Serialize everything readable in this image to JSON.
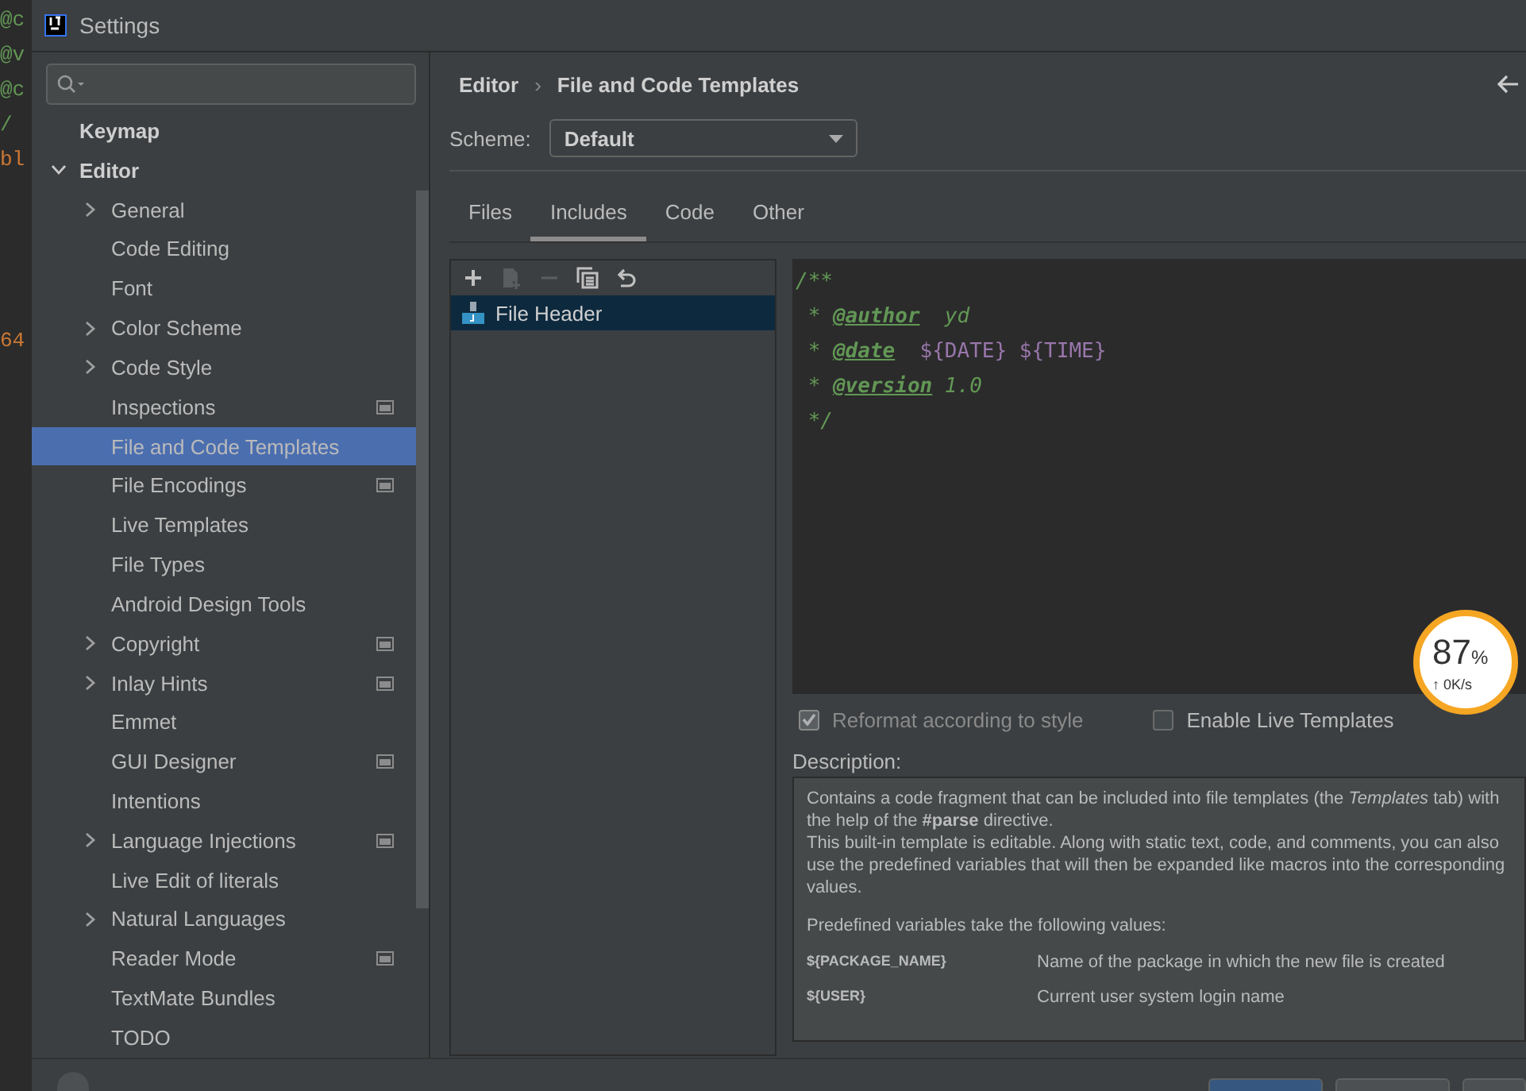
{
  "background_code": [
    "@c",
    "@v",
    "@c",
    "/",
    "bl",
    "64"
  ],
  "window": {
    "title": "Settings"
  },
  "sidebar": {
    "items": [
      {
        "label": "Keymap",
        "expandable": false,
        "selected": false,
        "project_level": false
      },
      {
        "label": "Editor",
        "expandable": true,
        "expanded": true,
        "selected": false,
        "project_level": false,
        "children": [
          {
            "label": "General",
            "expandable": true,
            "expanded": false,
            "selected": false,
            "project_level": false
          },
          {
            "label": "Code Editing",
            "expandable": false,
            "selected": false,
            "project_level": false
          },
          {
            "label": "Font",
            "expandable": false,
            "selected": false,
            "project_level": false
          },
          {
            "label": "Color Scheme",
            "expandable": true,
            "expanded": false,
            "selected": false,
            "project_level": false
          },
          {
            "label": "Code Style",
            "expandable": true,
            "expanded": false,
            "selected": false,
            "project_level": false
          },
          {
            "label": "Inspections",
            "expandable": false,
            "selected": false,
            "project_level": true
          },
          {
            "label": "File and Code Templates",
            "expandable": false,
            "selected": true,
            "project_level": false
          },
          {
            "label": "File Encodings",
            "expandable": false,
            "selected": false,
            "project_level": true
          },
          {
            "label": "Live Templates",
            "expandable": false,
            "selected": false,
            "project_level": false
          },
          {
            "label": "File Types",
            "expandable": false,
            "selected": false,
            "project_level": false
          },
          {
            "label": "Android Design Tools",
            "expandable": false,
            "selected": false,
            "project_level": false
          },
          {
            "label": "Copyright",
            "expandable": true,
            "expanded": false,
            "selected": false,
            "project_level": true
          },
          {
            "label": "Inlay Hints",
            "expandable": true,
            "expanded": false,
            "selected": false,
            "project_level": true
          },
          {
            "label": "Emmet",
            "expandable": false,
            "selected": false,
            "project_level": false
          },
          {
            "label": "GUI Designer",
            "expandable": false,
            "selected": false,
            "project_level": true
          },
          {
            "label": "Intentions",
            "expandable": false,
            "selected": false,
            "project_level": false
          },
          {
            "label": "Language Injections",
            "expandable": true,
            "expanded": false,
            "selected": false,
            "project_level": true
          },
          {
            "label": "Live Edit of literals",
            "expandable": false,
            "selected": false,
            "project_level": false
          },
          {
            "label": "Natural Languages",
            "expandable": true,
            "expanded": false,
            "selected": false,
            "project_level": false
          },
          {
            "label": "Reader Mode",
            "expandable": false,
            "selected": false,
            "project_level": true
          },
          {
            "label": "TextMate Bundles",
            "expandable": false,
            "selected": false,
            "project_level": false
          },
          {
            "label": "TODO",
            "expandable": false,
            "selected": false,
            "project_level": false
          }
        ]
      }
    ]
  },
  "breadcrumb": [
    "Editor",
    "File and Code Templates"
  ],
  "breadcrumb_separator": "›",
  "scheme": {
    "label": "Scheme:",
    "value": "Default"
  },
  "tabs": [
    {
      "label": "Files",
      "selected": false
    },
    {
      "label": "Includes",
      "selected": true
    },
    {
      "label": "Code",
      "selected": false
    },
    {
      "label": "Other",
      "selected": false
    }
  ],
  "toolbar": [
    {
      "kind": "add",
      "disabled": false
    },
    {
      "kind": "child",
      "disabled": true
    },
    {
      "kind": "remove",
      "disabled": true
    },
    {
      "kind": "copy",
      "disabled": false
    },
    {
      "kind": "reset",
      "disabled": false
    }
  ],
  "templates": [
    {
      "label": "File Header",
      "selected": true
    }
  ],
  "code_lines": [
    [
      {
        "text": "/**",
        "kind": "comment"
      }
    ],
    [
      {
        "text": " * ",
        "kind": "comment"
      },
      {
        "text": "@author",
        "kind": "tag"
      },
      {
        "text": "  yd",
        "kind": "value"
      }
    ],
    [
      {
        "text": " * ",
        "kind": "comment"
      },
      {
        "text": "@date",
        "kind": "tag"
      },
      {
        "text": "  ${DATE} ${TIME}",
        "kind": "variable"
      }
    ],
    [
      {
        "text": " * ",
        "kind": "comment"
      },
      {
        "text": "@version",
        "kind": "tag"
      },
      {
        "text": " 1.0",
        "kind": "value"
      }
    ],
    [
      {
        "text": " */",
        "kind": "comment"
      }
    ]
  ],
  "options": [
    {
      "label": "Reformat according to style",
      "checked": true,
      "disabled": true
    },
    {
      "label": "Enable Live Templates",
      "checked": false,
      "disabled": false
    }
  ],
  "description": {
    "label": "Description:",
    "paragraphs": [
      "Contains a code fragment that can be included into file templates (the *Templates* tab) with the help of the **#parse** directive.\nThis built-in template is editable. Along with static text, code, and comments, you can also use the predefined variables that will then be expanded like macros into the corresponding values.",
      "Predefined variables take the following values:"
    ],
    "variables": [
      {
        "name": "${PACKAGE_NAME}",
        "meaning": "Name of the package in which the new file is created"
      },
      {
        "name": "${USER}",
        "meaning": "Current user system login name"
      }
    ]
  },
  "speed_widget": {
    "percent": "87",
    "unit": "%",
    "arrow": "↑",
    "rate": "0K/s"
  }
}
